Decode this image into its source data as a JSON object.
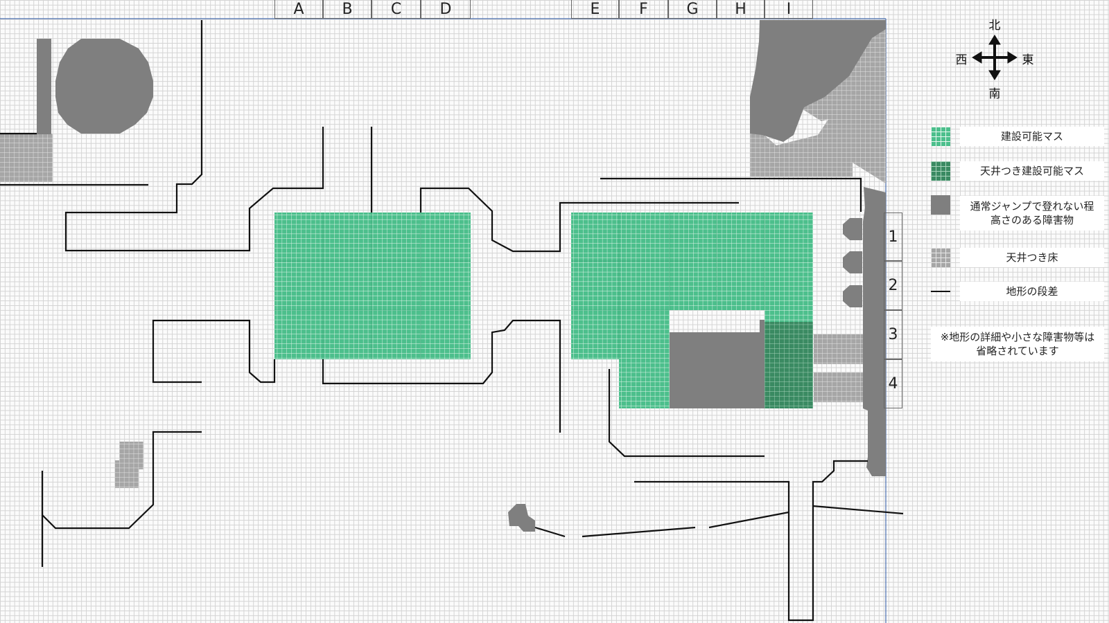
{
  "columns": [
    "A",
    "B",
    "C",
    "D",
    "E",
    "F",
    "G",
    "H",
    "I"
  ],
  "rows": [
    "1",
    "2",
    "3",
    "4"
  ],
  "compass": {
    "north": "北",
    "south": "南",
    "east": "東",
    "west": "西"
  },
  "legend": {
    "buildable": "建設可能マス",
    "buildable_ceiling": "天井つき建設可能マス",
    "obstacle_line1": "通常ジャンプで登れない程",
    "obstacle_line2": "高さのある障害物",
    "ceiling_floor": "天井つき床",
    "terrain_step": "地形の段差",
    "note_line1": "※地形の詳細や小さな障害物等は",
    "note_line2": "省略されています"
  },
  "colors": {
    "buildable": "#4cbf8c",
    "buildable_ceiling": "#3a8a62",
    "obstacle": "#7f7f7f",
    "ceiling_floor": "#a6a6a6",
    "step_line": "#111111"
  }
}
